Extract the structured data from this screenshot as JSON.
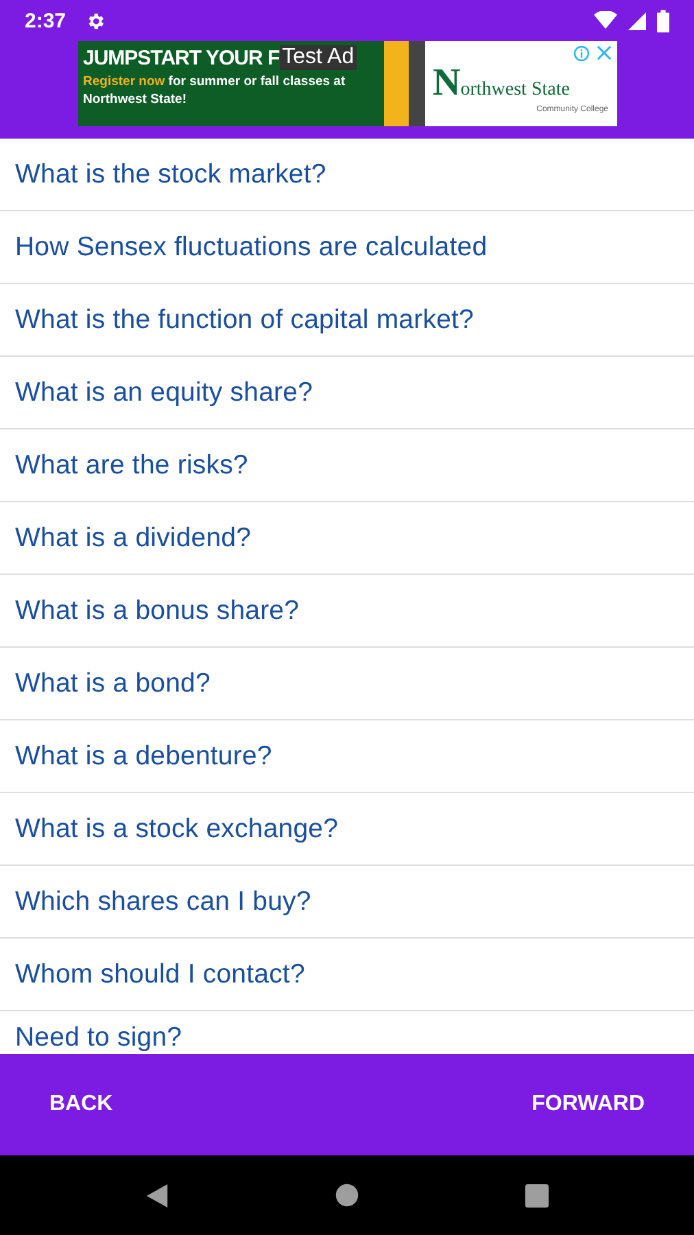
{
  "status_bar": {
    "time": "2:37"
  },
  "ad": {
    "headline": "JUMPSTART YOUR F",
    "label": "Test Ad",
    "highlight": "Register now",
    "body": " for summer or fall classes at Northwest State!",
    "brand": "orthwest State",
    "brand_initial": "N",
    "brand_sub": "Community College"
  },
  "questions": [
    {
      "text": "What is the stock market?"
    },
    {
      "text": "How Sensex fluctuations are calculated"
    },
    {
      "text": "What is the function of capital market?"
    },
    {
      "text": "What is an equity share?"
    },
    {
      "text": "What are the risks?"
    },
    {
      "text": "What is a dividend?"
    },
    {
      "text": "What is a bonus share?"
    },
    {
      "text": "What is a bond?"
    },
    {
      "text": "What is a debenture?"
    },
    {
      "text": "What is a stock exchange?"
    },
    {
      "text": "Which shares can I buy?"
    },
    {
      "text": "Whom should I contact?"
    },
    {
      "text": "Need to sign?"
    }
  ],
  "buttons": [
    "BACK",
    "FORWARD"
  ]
}
